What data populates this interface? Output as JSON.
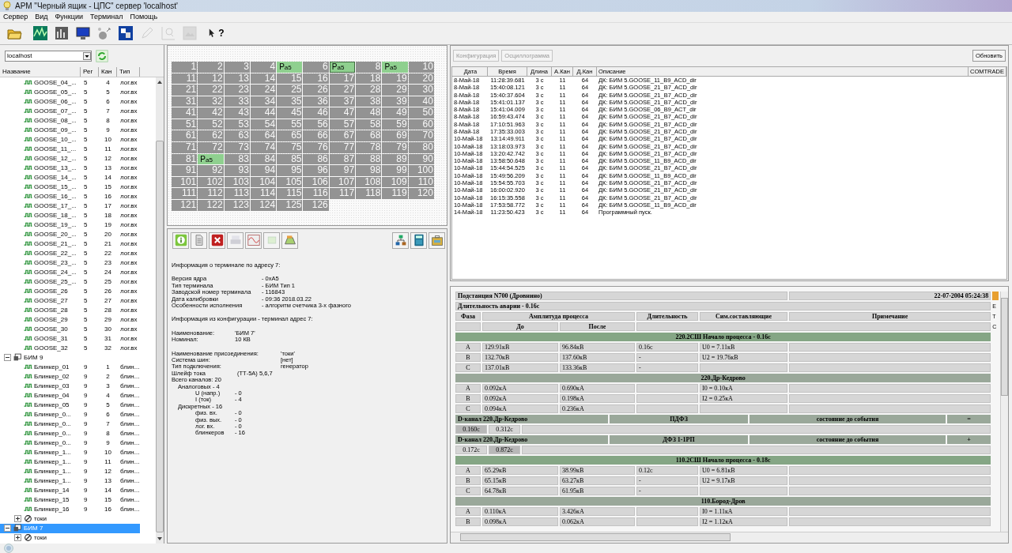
{
  "window": {
    "title": "АРМ \"Черный ящик - ЦПС\" сервер 'localhost'"
  },
  "menu": [
    "Сервер",
    "Вид",
    "Функции",
    "Терминал",
    "Помощь"
  ],
  "toolbar": [
    {
      "kind": "folder",
      "disabled": false
    },
    {
      "kind": "chart",
      "disabled": false
    },
    {
      "kind": "meter",
      "disabled": false
    },
    {
      "kind": "monitor",
      "disabled": false
    },
    {
      "kind": "balls",
      "disabled": false
    },
    {
      "kind": "cubes",
      "disabled": false
    },
    {
      "kind": "pencil",
      "disabled": true
    },
    {
      "kind": "magnifier",
      "disabled": true
    },
    {
      "kind": "image",
      "disabled": true
    },
    {
      "kind": "help",
      "label": "?",
      "disabled": false
    }
  ],
  "server": {
    "value": "localhost"
  },
  "tree": {
    "columns": [
      "Название",
      "Рег",
      "Кан",
      "Тип"
    ],
    "items": [
      {
        "children": [
          {
            "kind": "signal",
            "name": "GOOSE_04_...",
            "reg": "5",
            "chan": "4",
            "type": "лог.вх",
            "selected": false
          },
          {
            "kind": "signal",
            "name": "GOOSE_05_...",
            "reg": "5",
            "chan": "5",
            "type": "лог.вх",
            "selected": false
          },
          {
            "kind": "signal",
            "name": "GOOSE_06_...",
            "reg": "5",
            "chan": "6",
            "type": "лог.вх",
            "selected": false
          },
          {
            "kind": "signal",
            "name": "GOOSE_07_...",
            "reg": "5",
            "chan": "7",
            "type": "лог.вх",
            "selected": false
          },
          {
            "kind": "signal",
            "name": "GOOSE_08_...",
            "reg": "5",
            "chan": "8",
            "type": "лог.вх",
            "selected": false
          },
          {
            "kind": "signal",
            "name": "GOOSE_09_...",
            "reg": "5",
            "chan": "9",
            "type": "лог.вх",
            "selected": false
          },
          {
            "kind": "signal",
            "name": "GOOSE_10_...",
            "reg": "5",
            "chan": "10",
            "type": "лог.вх",
            "selected": false
          },
          {
            "kind": "signal",
            "name": "GOOSE_11_...",
            "reg": "5",
            "chan": "11",
            "type": "лог.вх",
            "selected": false
          },
          {
            "kind": "signal",
            "name": "GOOSE_12_...",
            "reg": "5",
            "chan": "12",
            "type": "лог.вх",
            "selected": false
          },
          {
            "kind": "signal",
            "name": "GOOSE_13_...",
            "reg": "5",
            "chan": "13",
            "type": "лог.вх",
            "selected": false
          },
          {
            "kind": "signal",
            "name": "GOOSE_14_...",
            "reg": "5",
            "chan": "14",
            "type": "лог.вх",
            "selected": false
          },
          {
            "kind": "signal",
            "name": "GOOSE_15_...",
            "reg": "5",
            "chan": "15",
            "type": "лог.вх",
            "selected": false
          },
          {
            "kind": "signal",
            "name": "GOOSE_16_...",
            "reg": "5",
            "chan": "16",
            "type": "лог.вх",
            "selected": false
          },
          {
            "kind": "signal",
            "name": "GOOSE_17_...",
            "reg": "5",
            "chan": "17",
            "type": "лог.вх",
            "selected": false
          },
          {
            "kind": "signal",
            "name": "GOOSE_18_...",
            "reg": "5",
            "chan": "18",
            "type": "лог.вх",
            "selected": false
          },
          {
            "kind": "signal",
            "name": "GOOSE_19_...",
            "reg": "5",
            "chan": "19",
            "type": "лог.вх",
            "selected": false
          },
          {
            "kind": "signal",
            "name": "GOOSE_20_...",
            "reg": "5",
            "chan": "20",
            "type": "лог.вх",
            "selected": false
          },
          {
            "kind": "signal",
            "name": "GOOSE_21_...",
            "reg": "5",
            "chan": "21",
            "type": "лог.вх",
            "selected": false
          },
          {
            "kind": "signal",
            "name": "GOOSE_22_...",
            "reg": "5",
            "chan": "22",
            "type": "лог.вх",
            "selected": false
          },
          {
            "kind": "signal",
            "name": "GOOSE_23_...",
            "reg": "5",
            "chan": "23",
            "type": "лог.вх",
            "selected": false
          },
          {
            "kind": "signal",
            "name": "GOOSE_24_...",
            "reg": "5",
            "chan": "24",
            "type": "лог.вх",
            "selected": false
          },
          {
            "kind": "signal",
            "name": "GOOSE_25_...",
            "reg": "5",
            "chan": "25",
            "type": "лог.вх",
            "selected": false
          },
          {
            "kind": "signal",
            "name": "GOOSE_26",
            "reg": "5",
            "chan": "26",
            "type": "лог.вх",
            "selected": false
          },
          {
            "kind": "signal",
            "name": "GOOSE_27",
            "reg": "5",
            "chan": "27",
            "type": "лог.вх",
            "selected": false
          },
          {
            "kind": "signal",
            "name": "GOOSE_28",
            "reg": "5",
            "chan": "28",
            "type": "лог.вх",
            "selected": false
          },
          {
            "kind": "signal",
            "name": "GOOSE_29",
            "reg": "5",
            "chan": "29",
            "type": "лог.вх",
            "selected": false
          },
          {
            "kind": "signal",
            "name": "GOOSE_30",
            "reg": "5",
            "chan": "30",
            "type": "лог.вх",
            "selected": false
          },
          {
            "kind": "signal",
            "name": "GOOSE_31",
            "reg": "5",
            "chan": "31",
            "type": "лог.вх",
            "selected": false
          },
          {
            "kind": "signal",
            "name": "GOOSE_32",
            "reg": "5",
            "chan": "32",
            "type": "лог.вх",
            "selected": false
          }
        ]
      },
      {
        "kind": "device",
        "name": "БИМ 9",
        "expanded": true,
        "selected": false,
        "children": [
          {
            "kind": "signal",
            "name": "Блинкер_01",
            "reg": "9",
            "chan": "1",
            "type": "блин...",
            "selected": false
          },
          {
            "kind": "signal",
            "name": "Блинкер_02",
            "reg": "9",
            "chan": "2",
            "type": "блин...",
            "selected": false
          },
          {
            "kind": "signal",
            "name": "Блинкер_03",
            "reg": "9",
            "chan": "3",
            "type": "блин...",
            "selected": false
          },
          {
            "kind": "signal",
            "name": "Блинкер_04",
            "reg": "9",
            "chan": "4",
            "type": "блин...",
            "selected": false
          },
          {
            "kind": "signal",
            "name": "Блинкер_05",
            "reg": "9",
            "chan": "5",
            "type": "блин...",
            "selected": false
          },
          {
            "kind": "signal",
            "name": "Блинкер_0...",
            "reg": "9",
            "chan": "6",
            "type": "блин...",
            "selected": false
          },
          {
            "kind": "signal",
            "name": "Блинкер_0...",
            "reg": "9",
            "chan": "7",
            "type": "блин...",
            "selected": false
          },
          {
            "kind": "signal",
            "name": "Блинкер_0...",
            "reg": "9",
            "chan": "8",
            "type": "блин...",
            "selected": false
          },
          {
            "kind": "signal",
            "name": "Блинкер_0...",
            "reg": "9",
            "chan": "9",
            "type": "блин...",
            "selected": false
          },
          {
            "kind": "signal",
            "name": "Блинкер_1...",
            "reg": "9",
            "chan": "10",
            "type": "блин...",
            "selected": false
          },
          {
            "kind": "signal",
            "name": "Блинкер_1...",
            "reg": "9",
            "chan": "11",
            "type": "блин...",
            "selected": false
          },
          {
            "kind": "signal",
            "name": "Блинкер_1...",
            "reg": "9",
            "chan": "12",
            "type": "блин...",
            "selected": false
          },
          {
            "kind": "signal",
            "name": "Блинкер_1...",
            "reg": "9",
            "chan": "13",
            "type": "блин...",
            "selected": false
          },
          {
            "kind": "signal",
            "name": "Блинкер_14",
            "reg": "9",
            "chan": "14",
            "type": "блин...",
            "selected": false
          },
          {
            "kind": "signal",
            "name": "Блинкер_15",
            "reg": "9",
            "chan": "15",
            "type": "блин...",
            "selected": false
          },
          {
            "kind": "signal",
            "name": "Блинкер_16",
            "reg": "9",
            "chan": "16",
            "type": "блин...",
            "selected": false
          },
          {
            "kind": "group",
            "name": "токи",
            "expanded": false,
            "selected": false
          }
        ]
      },
      {
        "kind": "device",
        "name": "БИМ 7",
        "expanded": true,
        "selected": true,
        "children": [
          {
            "kind": "group",
            "name": "токи",
            "expanded": false,
            "selected": false
          }
        ]
      }
    ]
  },
  "grid": {
    "cells": [
      {
        "label": "1"
      },
      {
        "label": "2"
      },
      {
        "label": "3"
      },
      {
        "label": "4"
      },
      {
        "label": "P",
        "sub": "a5",
        "selected": false
      },
      {
        "label": "6"
      },
      {
        "label": "P",
        "sub": "a5",
        "selected": true
      },
      {
        "label": "8"
      },
      {
        "label": "P",
        "sub": "a5",
        "selected": false
      },
      {
        "label": "10"
      },
      {
        "label": "11"
      },
      {
        "label": "12"
      },
      {
        "label": "13"
      },
      {
        "label": "14"
      },
      {
        "label": "15"
      },
      {
        "label": "16"
      },
      {
        "label": "17"
      },
      {
        "label": "18"
      },
      {
        "label": "19"
      },
      {
        "label": "20"
      },
      {
        "label": "21"
      },
      {
        "label": "22"
      },
      {
        "label": "23"
      },
      {
        "label": "24"
      },
      {
        "label": "25"
      },
      {
        "label": "26"
      },
      {
        "label": "27"
      },
      {
        "label": "28"
      },
      {
        "label": "29"
      },
      {
        "label": "30"
      },
      {
        "label": "31"
      },
      {
        "label": "32"
      },
      {
        "label": "33"
      },
      {
        "label": "34"
      },
      {
        "label": "35"
      },
      {
        "label": "36"
      },
      {
        "label": "37"
      },
      {
        "label": "38"
      },
      {
        "label": "39"
      },
      {
        "label": "40"
      },
      {
        "label": "41"
      },
      {
        "label": "42"
      },
      {
        "label": "43"
      },
      {
        "label": "44"
      },
      {
        "label": "45"
      },
      {
        "label": "46"
      },
      {
        "label": "47"
      },
      {
        "label": "48"
      },
      {
        "label": "49"
      },
      {
        "label": "50"
      },
      {
        "label": "51"
      },
      {
        "label": "52"
      },
      {
        "label": "53"
      },
      {
        "label": "54"
      },
      {
        "label": "55"
      },
      {
        "label": "56"
      },
      {
        "label": "57"
      },
      {
        "label": "58"
      },
      {
        "label": "59"
      },
      {
        "label": "60"
      },
      {
        "label": "61"
      },
      {
        "label": "62"
      },
      {
        "label": "63"
      },
      {
        "label": "64"
      },
      {
        "label": "65"
      },
      {
        "label": "66"
      },
      {
        "label": "67"
      },
      {
        "label": "68"
      },
      {
        "label": "69"
      },
      {
        "label": "70"
      },
      {
        "label": "71"
      },
      {
        "label": "72"
      },
      {
        "label": "73"
      },
      {
        "label": "74"
      },
      {
        "label": "75"
      },
      {
        "label": "76"
      },
      {
        "label": "77"
      },
      {
        "label": "78"
      },
      {
        "label": "79"
      },
      {
        "label": "80"
      },
      {
        "label": "81"
      },
      {
        "label": "P",
        "sub": "a5",
        "selected": false
      },
      {
        "label": "83"
      },
      {
        "label": "84"
      },
      {
        "label": "85"
      },
      {
        "label": "86"
      },
      {
        "label": "87"
      },
      {
        "label": "88"
      },
      {
        "label": "89"
      },
      {
        "label": "90"
      },
      {
        "label": "91"
      },
      {
        "label": "92"
      },
      {
        "label": "93"
      },
      {
        "label": "94"
      },
      {
        "label": "95"
      },
      {
        "label": "96"
      },
      {
        "label": "97"
      },
      {
        "label": "98"
      },
      {
        "label": "99"
      },
      {
        "label": "100"
      },
      {
        "label": "101"
      },
      {
        "label": "102"
      },
      {
        "label": "103"
      },
      {
        "label": "104"
      },
      {
        "label": "105"
      },
      {
        "label": "106"
      },
      {
        "label": "107"
      },
      {
        "label": "108"
      },
      {
        "label": "109"
      },
      {
        "label": "110"
      },
      {
        "label": "111"
      },
      {
        "label": "112"
      },
      {
        "label": "113"
      },
      {
        "label": "114"
      },
      {
        "label": "115"
      },
      {
        "label": "116"
      },
      {
        "label": "117"
      },
      {
        "label": "118"
      },
      {
        "label": "119"
      },
      {
        "label": "120"
      },
      {
        "label": "121"
      },
      {
        "label": "122"
      },
      {
        "label": "123"
      },
      {
        "label": "124"
      },
      {
        "label": "125"
      },
      {
        "label": "126"
      }
    ]
  },
  "info_toolbar": {
    "left": [
      {
        "kind": "info",
        "disabled": false
      },
      {
        "kind": "document",
        "disabled": false
      },
      {
        "kind": "delete",
        "disabled": false
      },
      {
        "kind": "printer",
        "disabled": true
      },
      {
        "kind": "wave",
        "disabled": false
      },
      {
        "kind": "frame",
        "disabled": true
      },
      {
        "kind": "scanner",
        "disabled": false
      }
    ],
    "right": [
      {
        "kind": "network",
        "disabled": false
      },
      {
        "kind": "calculator",
        "disabled": false
      },
      {
        "kind": "case",
        "disabled": false
      }
    ]
  },
  "info": [
    {
      "kind": "heading",
      "text": "Информация о терминале по адресу 7:"
    },
    {
      "kind": "kv-wide",
      "rows": [
        [
          "Версия ядра",
          "- 0xA5"
        ],
        [
          "Тип терминала",
          "- БИМ Тип 1"
        ],
        [
          "Заводской номер терминала",
          "- 116843"
        ],
        [
          "Дата калибровки",
          "- 09:36 2018.03.22"
        ],
        [
          "Особенности исполнения",
          "- алгоритм счетчика 3-х фазного"
        ]
      ]
    },
    {
      "kind": "heading",
      "text": "Информация из конфигурации - терминал адрес 7:"
    },
    {
      "kind": "kv-short",
      "rows": [
        [
          "Наименование:",
          "'БИМ 7'"
        ],
        [
          "Номинал:",
          "10 КВ"
        ]
      ]
    },
    {
      "kind": "kv-long",
      "rows": [
        [
          "Наименование присоединения:",
          "'токи'"
        ],
        [
          "Система шин:",
          "[нет]"
        ],
        [
          "Тип подключения:",
          "генератор"
        ]
      ]
    },
    {
      "kind": "kv-short-tight",
      "rows": [
        [
          "Шлейф тока",
          "(ТТ-5А) 5,6,7"
        ]
      ]
    },
    {
      "kind": "text",
      "text": "Всего каналов: 20"
    },
    {
      "kind": "sub",
      "text": "Аналоговых  - 4"
    },
    {
      "kind": "kv-sub",
      "rows": [
        [
          "U (напр.)",
          "- 0"
        ],
        [
          "I (ток)",
          "- 4"
        ]
      ]
    },
    {
      "kind": "sub",
      "text": "Дискретных  - 16"
    },
    {
      "kind": "kv-sub",
      "rows": [
        [
          "физ. вх.",
          "- 0"
        ],
        [
          "физ. вых.",
          "- 0"
        ],
        [
          "лог. вх.",
          "- 0"
        ],
        [
          "блинкеров",
          "- 16"
        ]
      ]
    }
  ],
  "events": {
    "buttons": [
      {
        "label": "Конфигурация",
        "disabled": true
      },
      {
        "label": "Осциллограмма",
        "disabled": true
      }
    ],
    "refresh": {
      "label": "Обновить",
      "disabled": false
    },
    "columns": [
      "Дата",
      "Время",
      "Длина",
      "А.Кан",
      "Д.Кан",
      "Описание",
      "COMTRADE"
    ],
    "rows": [
      [
        "8-Май-18",
        "11:28:39.681",
        "3 с",
        "11",
        "64",
        "ДК: БИМ 5.GOOSE_11_B9_ACD_dir"
      ],
      [
        "8-Май-18",
        "15:40:08.121",
        "3 с",
        "11",
        "64",
        "ДК: БИМ 5.GOOSE_21_B7_ACD_dir"
      ],
      [
        "8-Май-18",
        "15:40:37.604",
        "3 с",
        "11",
        "64",
        "ДК: БИМ 5.GOOSE_21_B7_ACD_dir"
      ],
      [
        "8-Май-18",
        "15:41:01.137",
        "3 с",
        "11",
        "64",
        "ДК: БИМ 5.GOOSE_21_B7_ACD_dir"
      ],
      [
        "8-Май-18",
        "15:41:04.009",
        "3 с",
        "11",
        "64",
        "ДК: БИМ 5.GOOSE_06_B9_ACT_dir"
      ],
      [
        "8-Май-18",
        "16:59:43.474",
        "3 с",
        "11",
        "64",
        "ДК: БИМ 5.GOOSE_21_B7_ACD_dir"
      ],
      [
        "8-Май-18",
        "17:10:51.963",
        "3 с",
        "11",
        "64",
        "ДК: БИМ 5.GOOSE_21_B7_ACD_dir"
      ],
      [
        "8-Май-18",
        "17:35:33.003",
        "3 с",
        "11",
        "64",
        "ДК: БИМ 5.GOOSE_21_B7_ACD_dir"
      ],
      [
        "10-Май-18",
        "13:14:49.911",
        "3 с",
        "11",
        "64",
        "ДК: БИМ 5.GOOSE_21_B7_ACD_dir"
      ],
      [
        "10-Май-18",
        "13:18:03.973",
        "3 с",
        "11",
        "64",
        "ДК: БИМ 5.GOOSE_21_B7_ACD_dir"
      ],
      [
        "10-Май-18",
        "13:20:42.742",
        "3 с",
        "11",
        "64",
        "ДК: БИМ 5.GOOSE_21_B7_ACD_dir"
      ],
      [
        "10-Май-18",
        "13:58:50.648",
        "3 с",
        "11",
        "64",
        "ДК: БИМ 5.GOOSE_11_B9_ACD_dir"
      ],
      [
        "10-Май-18",
        "15:44:54.525",
        "3 с",
        "11",
        "64",
        "ДК: БИМ 5.GOOSE_21_B7_ACD_dir"
      ],
      [
        "10-Май-18",
        "15:49:56.209",
        "3 с",
        "11",
        "64",
        "ДК: БИМ 5.GOOSE_11_B9_ACD_dir"
      ],
      [
        "10-Май-18",
        "15:54:55.703",
        "3 с",
        "11",
        "64",
        "ДК: БИМ 5.GOOSE_21_B7_ACD_dir"
      ],
      [
        "10-Май-18",
        "16:00:02.920",
        "3 с",
        "11",
        "64",
        "ДК: БИМ 5.GOOSE_21_B7_ACD_dir"
      ],
      [
        "10-Май-18",
        "16:15:35.558",
        "3 с",
        "11",
        "64",
        "ДК: БИМ 5.GOOSE_21_B7_ACD_dir"
      ],
      [
        "10-Май-18",
        "17:53:58.772",
        "3 с",
        "11",
        "64",
        "ДК: БИМ 5.GOOSE_11_B9_ACD_dir"
      ],
      [
        "14-Май-18",
        "11:23:50.423",
        "3 с",
        "11",
        "64",
        "Программный пуск."
      ]
    ]
  },
  "report": {
    "station": "Подстанция N700 (Дровнино)",
    "date": "22-07-2004 05:24:38",
    "duration": "Длительность аварии - 0.16с",
    "columns": {
      "phase": "Фаза",
      "amplitude": "Амплитуда процесса",
      "length": "Длительность",
      "sym": "Сим.составляющие",
      "note": "Примечание",
      "before": "До",
      "after": "После"
    },
    "blocks": [
      {
        "kind": "process",
        "title": "220.2СШ Начало процесса - 0.16с",
        "rows": [
          {
            "phase": "A",
            "before": "129.91кВ",
            "after": "96.84кВ",
            "length": "0.16с",
            "sym": "U0 = 7.11кВ"
          },
          {
            "phase": "B",
            "before": "132.70кВ",
            "after": "137.60кВ",
            "length": "-",
            "sym": "U2 = 19.76кВ"
          },
          {
            "phase": "C",
            "before": "137.01кВ",
            "after": "133.36кВ",
            "length": "-"
          }
        ]
      },
      {
        "kind": "line",
        "title": "220.Др-Кедрово",
        "rows": [
          {
            "phase": "A",
            "before": "0.092кА",
            "after": "0.690кА",
            "sym": "I0 = 0.10кА"
          },
          {
            "phase": "B",
            "before": "0.092кА",
            "after": "0.198кА",
            "sym": "I2 = 0.25кА"
          },
          {
            "phase": "C",
            "before": "0.094кА",
            "after": "0.236кА"
          }
        ]
      },
      {
        "kind": "dchannel",
        "name": "D-канал 220.Др-Кедрово",
        "protection": "ПДФЗ",
        "state": "состояние до события",
        "sign": "=",
        "times": [
          {
            "text": "0.160с",
            "selected": true
          },
          {
            "text": "0.312с",
            "selected": false
          }
        ]
      },
      {
        "kind": "dchannel",
        "name": "D-канал 220.Др-Кедрово",
        "protection": "ДФЗ 1-1РП",
        "state": "состояние до события",
        "sign": "+",
        "times": [
          {
            "text": "0.172с",
            "selected": false
          },
          {
            "text": "0.872с",
            "selected": true
          }
        ]
      },
      {
        "kind": "process",
        "title": "110.2СШ Начало процесса - 0.18с",
        "rows": [
          {
            "phase": "A",
            "before": "65.29кВ",
            "after": "38.99кВ",
            "length": "0.12с",
            "sym": "U0 = 6.81кВ"
          },
          {
            "phase": "B",
            "before": "65.15кВ",
            "after": "63.27кВ",
            "length": "-",
            "sym": "U2 = 9.17кВ"
          },
          {
            "phase": "C",
            "before": "64.78кВ",
            "after": "61.95кВ",
            "length": "-"
          }
        ]
      },
      {
        "kind": "line",
        "title": "110.Бород-Дров",
        "rows": [
          {
            "phase": "A",
            "before": "0.110кА",
            "after": "3.426кА",
            "sym": "I0 = 1.11кА"
          },
          {
            "phase": "B",
            "before": "0.098кА",
            "after": "0.062кА",
            "sym": "I2 = 1.12кА"
          }
        ]
      }
    ]
  },
  "side_strip": [
    "E",
    "T",
    "C"
  ]
}
